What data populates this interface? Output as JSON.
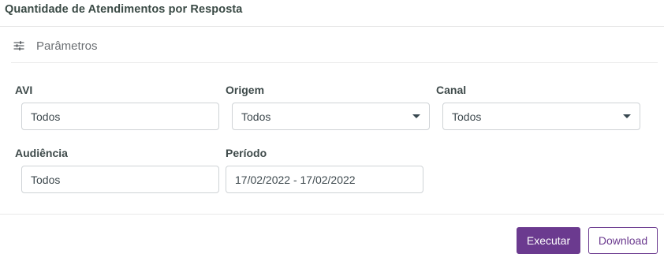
{
  "page": {
    "title": "Quantidade de Atendimentos por Resposta"
  },
  "parameters": {
    "section_label": "Parâmetros",
    "icon": "sliders-icon"
  },
  "filters": {
    "avi": {
      "label": "AVI",
      "value": "Todos"
    },
    "origem": {
      "label": "Origem",
      "value": "Todos",
      "type": "select"
    },
    "canal": {
      "label": "Canal",
      "value": "Todos",
      "type": "select"
    },
    "audiencia": {
      "label": "Audiência",
      "value": "Todos"
    },
    "periodo": {
      "label": "Período",
      "value": "17/02/2022 - 17/02/2022"
    }
  },
  "actions": {
    "execute_label": "Executar",
    "download_label": "Download"
  },
  "colors": {
    "accent": "#6b3a8f",
    "border": "#cfd3d6",
    "text": "#3e4a4a"
  }
}
